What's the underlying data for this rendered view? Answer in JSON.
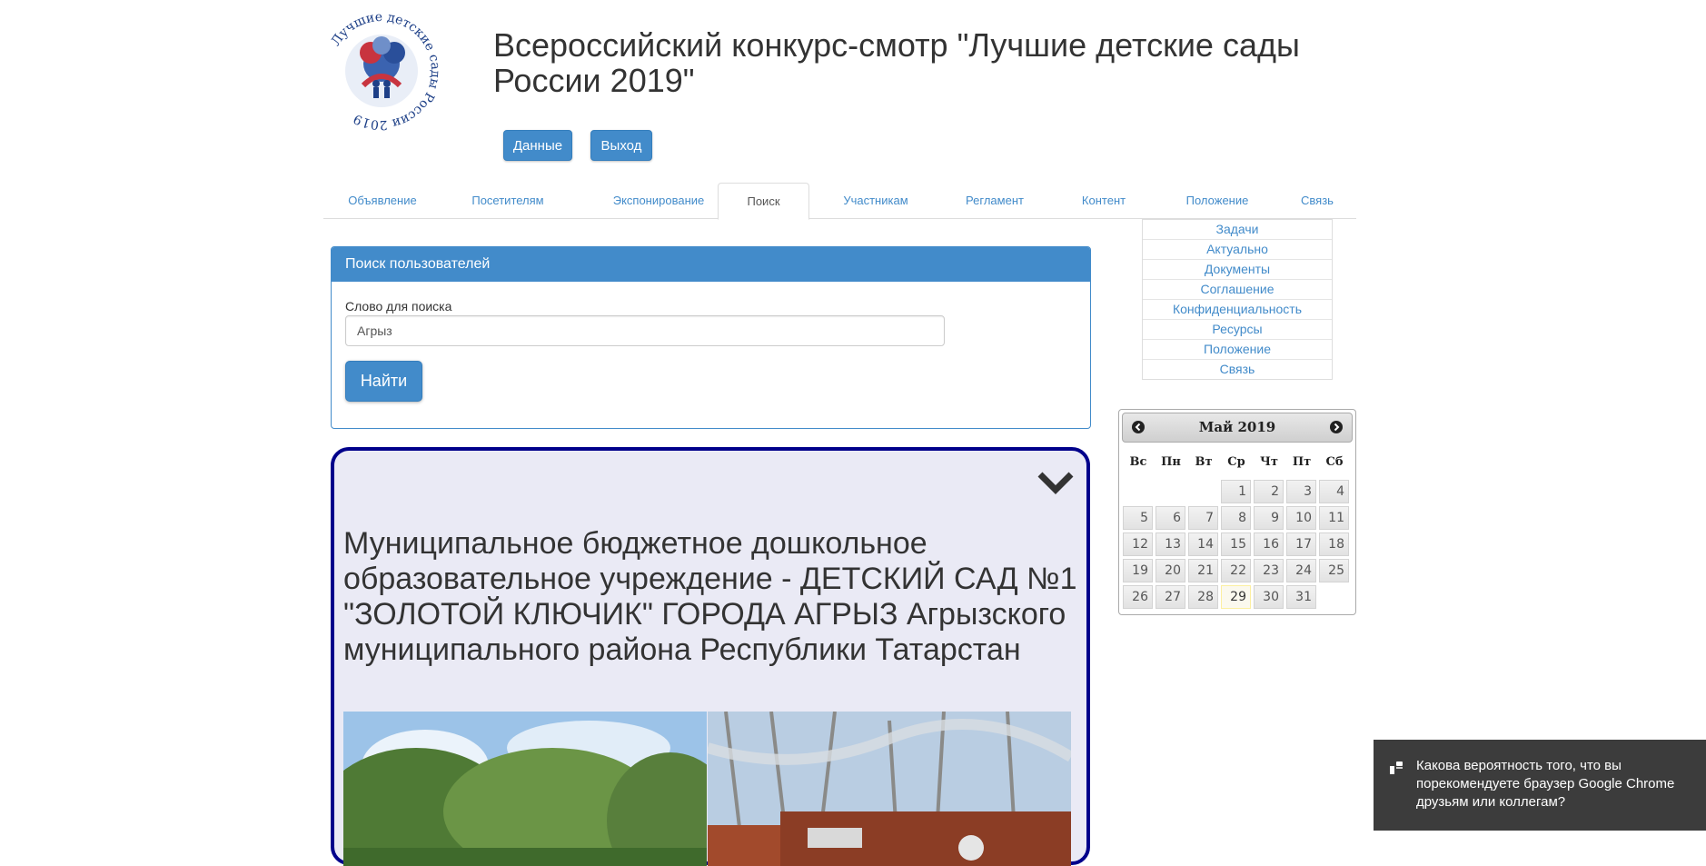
{
  "header": {
    "logo_text": "Лучшие детские сады России 2019",
    "title": "Всероссийский конкурс-смотр \"Лучшие детские сады России 2019\"",
    "btn_data": "Данные",
    "btn_exit": "Выход"
  },
  "tabs": [
    {
      "label": "Объявление"
    },
    {
      "label": "Посетителям"
    },
    {
      "label": "Экспонирование"
    },
    {
      "label": "Поиск",
      "active": true
    },
    {
      "label": "Участникам"
    },
    {
      "label": "Регламент"
    },
    {
      "label": "Контент"
    },
    {
      "label": "Положение"
    },
    {
      "label": "Связь"
    }
  ],
  "side_menu": [
    "Задачи",
    "Актуально",
    "Документы",
    "Соглашение",
    "Конфиденциальность",
    "Ресурсы",
    "Положение",
    "Связь"
  ],
  "search": {
    "panel_title": "Поиск пользователей",
    "label": "Слово для поиска",
    "value": "Агрыз",
    "button": "Найти"
  },
  "result": {
    "org_name": "Муниципальное бюджетное дошкольное образовательное учреждение - ДЕТСКИЙ САД №1 \"ЗОЛОТОЙ КЛЮЧИК\" ГОРОДА АГРЫЗ Агрызского муниципального района Республики Татарстан"
  },
  "calendar": {
    "title": "Май 2019",
    "weekdays": [
      "Вс",
      "Пн",
      "Вт",
      "Ср",
      "Чт",
      "Пт",
      "Сб"
    ],
    "days": [
      "1",
      "2",
      "3",
      "4",
      "5",
      "6",
      "7",
      "8",
      "9",
      "10",
      "11",
      "12",
      "13",
      "14",
      "15",
      "16",
      "17",
      "18",
      "19",
      "20",
      "21",
      "22",
      "23",
      "24",
      "25",
      "26",
      "27",
      "28",
      "29",
      "30",
      "31"
    ],
    "today": "29"
  },
  "notification": {
    "text": "Какова вероятность того, что вы порекомендуете браузер Google Chrome друзьям или коллегам?"
  },
  "colors": {
    "primary": "#428bca",
    "card_border": "#00008b",
    "card_bg": "#eaeaf5"
  }
}
